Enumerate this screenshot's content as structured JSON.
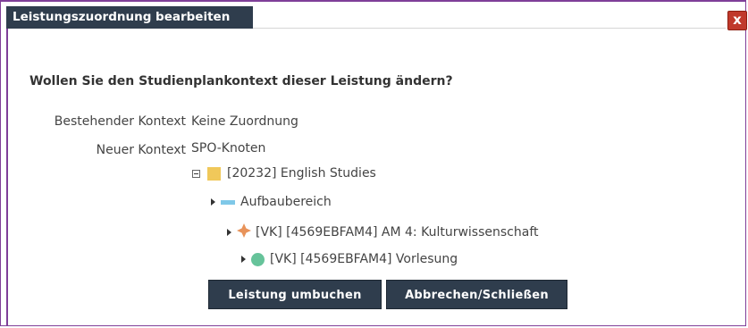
{
  "dialog": {
    "title": "Leistungszuordnung bearbeiten",
    "close_label": "x",
    "question": "Wollen Sie den Studienplankontext dieser Leistung ändern?"
  },
  "context": {
    "existing_label": "Bestehender Kontext",
    "existing_value": "Keine Zuordnung",
    "new_label": "Neuer Kontext",
    "new_value": "SPO-Knoten"
  },
  "tree": {
    "root": "[20232] English Studies",
    "level1": "Aufbaubereich",
    "level2": "[VK] [4569EBFAM4] AM 4: Kulturwissenschaft",
    "level3": "[VK] [4569EBFAM4] Vorlesung"
  },
  "buttons": {
    "rebook": "Leistung umbuchen",
    "cancel": "Abbrechen/Schließen"
  },
  "colors": {
    "frame": "#7f3f98",
    "titlebar": "#2f3d4d",
    "close": "#c0392b",
    "folder": "#f0c85a",
    "bar": "#7fc8e8",
    "cross": "#e8935a",
    "circle": "#66c39a"
  }
}
